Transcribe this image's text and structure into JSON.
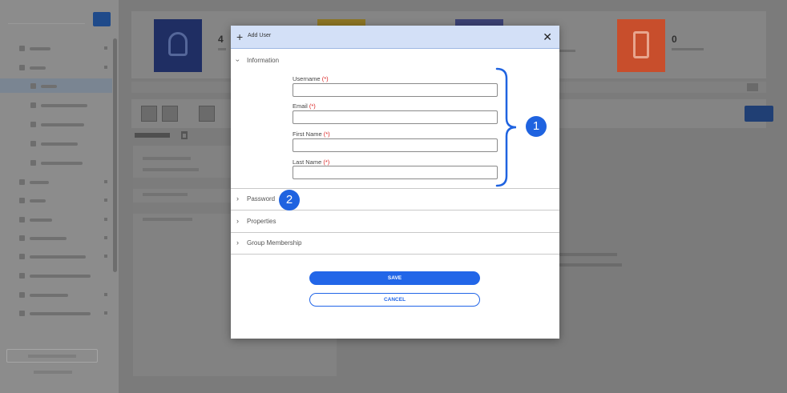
{
  "dialog": {
    "title": "Add User",
    "plus_icon": "plus-icon",
    "close_icon": "close-icon",
    "plus_glyph": "+",
    "close_glyph": "✕"
  },
  "sections": {
    "information": {
      "label": "Information",
      "expanded": true
    },
    "password": {
      "label": "Password",
      "expanded": false
    },
    "properties": {
      "label": "Properties",
      "expanded": false
    },
    "group_membership": {
      "label": "Group Membership",
      "expanded": false
    }
  },
  "fields": {
    "username": {
      "label": "Username",
      "required_mark": "(*)",
      "value": "",
      "placeholder": ""
    },
    "email": {
      "label": "Email",
      "required_mark": "(*)",
      "value": "",
      "placeholder": ""
    },
    "first_name": {
      "label": "First Name",
      "required_mark": "(*)",
      "value": "",
      "placeholder": ""
    },
    "last_name": {
      "label": "Last Name",
      "required_mark": "(*)",
      "value": "",
      "placeholder": ""
    }
  },
  "buttons": {
    "save": "SAVE",
    "cancel": "CANCEL"
  },
  "callouts": {
    "one": "1",
    "two": "2"
  },
  "background": {
    "tile_counts": [
      "4",
      "0"
    ]
  },
  "colors": {
    "accent": "#2266e8",
    "header_bg": "#d3e0f7",
    "required": "#d81b1b",
    "callout": "#1f63e0"
  }
}
